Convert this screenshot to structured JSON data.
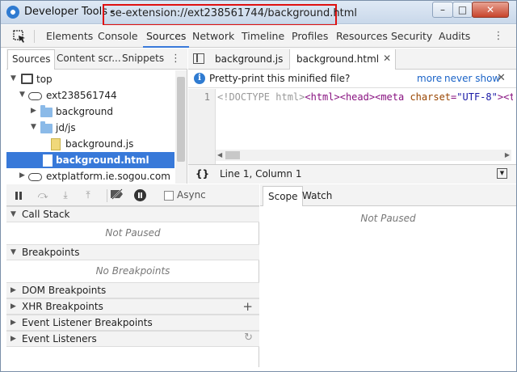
{
  "window": {
    "title_prefix": "Developer Tools -",
    "title_url": "se-extension://ext238561744/background.html",
    "controls": {
      "minimize": "–",
      "maximize": "□",
      "close": "✕"
    },
    "highlight_color": "#e01010"
  },
  "main_tabs": [
    "Elements",
    "Console",
    "Sources",
    "Network",
    "Timeline",
    "Profiles",
    "Resources",
    "Security",
    "Audits"
  ],
  "active_main_tab": "Sources",
  "navigator": {
    "tabs": [
      "Sources",
      "Content scr...",
      "Snippets"
    ],
    "tree": [
      {
        "label": "top",
        "icon": "frame-icon",
        "expanded": true
      },
      {
        "label": "ext238561744",
        "icon": "cloud-icon",
        "expanded": true
      },
      {
        "label": "background",
        "icon": "folder-icon",
        "expanded": false
      },
      {
        "label": "jd/js",
        "icon": "folder-icon",
        "expanded": true
      },
      {
        "label": "background.js",
        "icon": "file-icon"
      },
      {
        "label": "background.html",
        "icon": "file-icon",
        "selected": true
      },
      {
        "label": "extplatform.ie.sogou.com",
        "icon": "cloud-icon",
        "expanded": false
      }
    ]
  },
  "editor": {
    "tabs": [
      "background.js",
      "background.html"
    ],
    "active_tab": "background.html",
    "infobar": {
      "message": "Pretty-print this minified file?",
      "yes_link": "more",
      "never_link": "never show"
    },
    "line_number": "1",
    "code": {
      "doctype": "<!DOCTYPE html>",
      "html_open": "<html>",
      "head_open": "<head>",
      "meta_open": "<meta ",
      "attr": "charset",
      "eq": "=",
      "val": "\"UTF-8\"",
      "meta_close": ">",
      "title_open": "<ti"
    },
    "status": {
      "braces": "{}",
      "cursor": "Line 1, Column 1"
    }
  },
  "debugger": {
    "async_label": "Async",
    "sections": [
      {
        "title": "Call Stack",
        "expanded": true,
        "empty_text": "Not Paused"
      },
      {
        "title": "Breakpoints",
        "expanded": true,
        "empty_text": "No Breakpoints"
      },
      {
        "title": "DOM Breakpoints",
        "expanded": false
      },
      {
        "title": "XHR Breakpoints",
        "expanded": false,
        "action": "+"
      },
      {
        "title": "Event Listener Breakpoints",
        "expanded": false
      },
      {
        "title": "Event Listeners",
        "expanded": false,
        "action": "↻"
      }
    ]
  },
  "scope": {
    "tabs": [
      "Scope",
      "Watch"
    ],
    "active_tab": "Scope",
    "empty_text": "Not Paused"
  },
  "colors": {
    "accent": "#3879d9",
    "link": "#1a63c7"
  }
}
